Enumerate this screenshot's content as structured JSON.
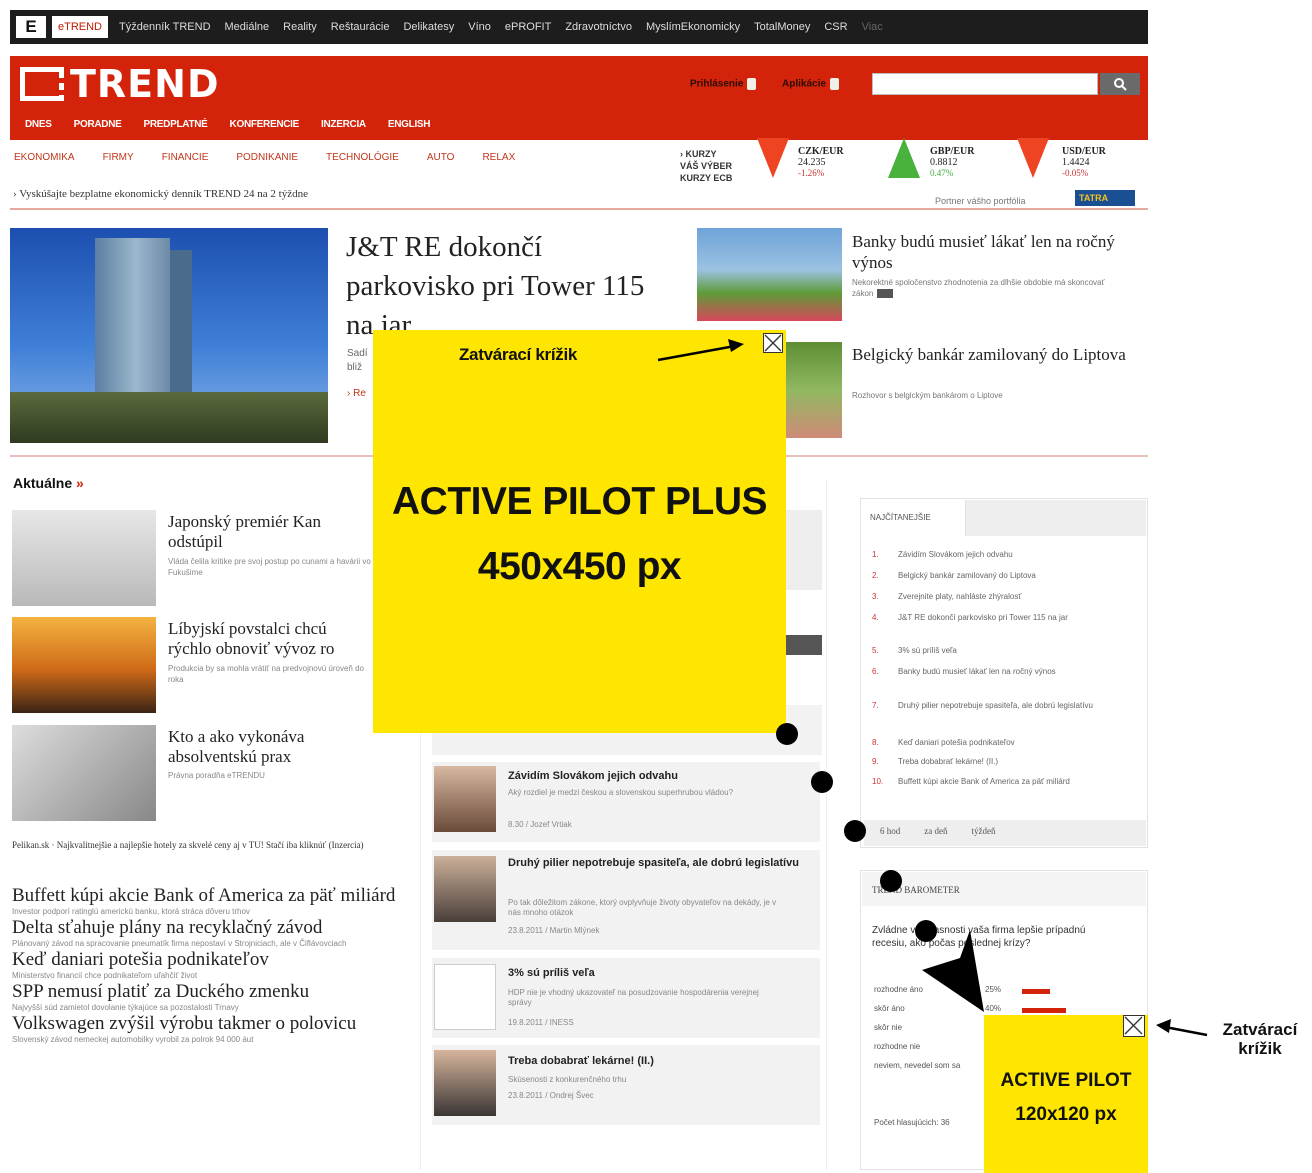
{
  "portal": {
    "logo": "E",
    "items": [
      {
        "label": "eTREND",
        "active": true
      },
      {
        "label": "Týždenník TREND"
      },
      {
        "label": "Mediálne"
      },
      {
        "label": "Reality"
      },
      {
        "label": "Reštaurácie"
      },
      {
        "label": "Delikatesy"
      },
      {
        "label": "Víno"
      },
      {
        "label": "ePROFIT"
      },
      {
        "label": "Zdravotníctvo"
      },
      {
        "label": "MyslímEkonomicky"
      },
      {
        "label": "TotalMoney"
      },
      {
        "label": "CSR"
      },
      {
        "label": "Viac",
        "faded": true
      }
    ]
  },
  "header": {
    "brand": "TREND",
    "login": "Prihlásenie",
    "register": "Aplikácie",
    "search_icon": "search-icon",
    "main_nav": [
      "DNES",
      "PORADNE",
      "PREDPLATNÉ",
      "KONFERENCIE",
      "INZERCIA",
      "ENGLISH"
    ],
    "sub_nav": [
      "EKONOMIKA",
      "FIRMY",
      "FINANCIE",
      "PODNIKANIE",
      "TECHNOLÓGIE",
      "AUTO",
      "RELAX"
    ],
    "promo": "› Vyskúšajte bezplatne ekonomický denník TREND 24 na 2 týždne"
  },
  "rates": {
    "labels": [
      "› KURZY",
      "VÁŠ VÝBER",
      "KURZY ECB"
    ],
    "items": [
      {
        "name": "CZK/EUR",
        "value": "24.235",
        "change": "-1.26%",
        "dir": "down"
      },
      {
        "name": "GBP/EUR",
        "value": "0.8812",
        "change": "0.47%",
        "dir": "up"
      },
      {
        "name": "USD/EUR",
        "value": "1.4424",
        "change": "-0.05%",
        "dir": "down"
      }
    ],
    "portfolio": "Portner vášho portfólia",
    "sponsor": "TATRA"
  },
  "hero": {
    "title": "J&T RE dokončí parkovisko pri Tower 115 na jar",
    "frag1": "Sadí",
    "frag2": "bliž",
    "frag3": "› Re"
  },
  "top_stories": [
    {
      "title": "Banky budú musieť lákať len na ročný výnos",
      "desc": "Nekorektné spoločenstvo zhodnotenia za dlhšie obdobie má skoncovať zákon"
    },
    {
      "title": "Belgický bankár zamilovaný do Liptova",
      "desc": "Rozhovor s belgickým bankárom o Liptove"
    }
  ],
  "aktualne": {
    "heading": "Aktuálne",
    "chevron": "»",
    "items": [
      {
        "title": "Japonský premiér Kan odstúpil",
        "desc": "Vláda čelila kritike pre svoj postup po cunami a havárii vo Fukušime"
      },
      {
        "title": "Líbyjskí povstalci chcú rýchlo obnoviť vývoz ro",
        "desc": "Produkcia by sa mohla vrátiť na predvojnovú úroveň do roka"
      },
      {
        "title": "Kto a ako vykonáva absolventskú prax",
        "desc": "Právna poradňa eTRENDU"
      }
    ],
    "pelikan": "Pelikan.sk · Najkvalitnejšie a najlepšie hotely za skvelé ceny aj v TU! Stačí iba kliknúť (Inzercia)",
    "list": [
      {
        "title": "Buffett kúpi akcie Bank of America za päť miliárd",
        "desc": "Investor podporí ratinglú americkú banku, ktorá stráca dôveru trhov"
      },
      {
        "title": "Delta sťahuje plány na recyklačný závod",
        "desc": "Plánovaný závod na spracovanie pneumatík firma nepostaví v Strojniciach, ale v Čiflávovciach"
      },
      {
        "title": "Keď daniari potešia podnikateľov",
        "desc": "Ministerstvo financií chce podnikateľom uľahčiť život"
      },
      {
        "title": "SPP nemusí platiť za Duckého zmenku",
        "desc": "Najvyšší súd zamietol dovolanie týkajúce sa pozostalosti Trnavy"
      },
      {
        "title": "Volkswagen zvýšil výrobu takmer o polovicu",
        "desc": "Slovenský závod nemeckej automobilky vyrobil za polrok 94 000 áut"
      }
    ]
  },
  "middle": {
    "items": [
      {
        "title": "Závidím Slovákom jejich odvahu",
        "desc": "Aký rozdiel je medzi českou a slovenskou superhrubou vládou?",
        "meta": "8.30 / Jozef Vrtiak"
      },
      {
        "title": "Druhý pilier nepotrebuje spasiteľa, ale dobrú legislatívu",
        "desc": "Po tak dôležitom zákone, ktorý ovplyvňuje životy obyvateľov na dekády, je v nás mnoho otázok",
        "meta": "23.8.2011 / Martin Mlýnek"
      },
      {
        "title": "3% sú príliš veľa",
        "desc": "HDP nie je vhodný ukazovateľ na posudzovanie hospodárenia verejnej správy",
        "meta": "19.8.2011 / INESS"
      },
      {
        "title": "Treba dobabrať lekárne! (II.)",
        "desc": "Skúsenosti z konkurenčného trhu",
        "meta": "23.8.2011 / Ondrej Švec"
      }
    ]
  },
  "najcitanejsie": {
    "tab": "NAJČÍTANEJŠIE",
    "items": [
      "Závidím Slovákom jejich odvahu",
      "Belgický bankár zamilovaný do Liptova",
      "Zverejnite platy, nahláste zhýralosť",
      "J&T RE dokončí parkovisko pri Tower 115 na jar",
      "3% sú príliš veľa",
      "Banky budú musieť lákať len na ročný výnos",
      "Druhý pilier nepotrebuje spasiteľa, ale dobrú legislatívu",
      "Keď daniari potešia podnikateľov",
      "Treba dobabrať lekárne! (II.)",
      "Buffett kúpi akcie Bank of America za päť miliárd"
    ],
    "periods": [
      "6 hod",
      "za deň",
      "týždeň"
    ]
  },
  "barometer": {
    "title": "TREND BAROMETER",
    "question": "Zvládne v súčasnosti vaša firma lepšie prípadnú recesiu, ako počas poslednej krízy?",
    "rows": [
      {
        "label": "rozhodne áno",
        "pct": "25%",
        "frac": 0.25
      },
      {
        "label": "skôr áno",
        "pct": "40%",
        "frac": 0.4
      },
      {
        "label": "skôr nie",
        "pct": "",
        "frac": 0
      },
      {
        "label": "rozhodne nie",
        "pct": "",
        "frac": 0
      },
      {
        "label": "neviem, nevedel som sa",
        "pct": "",
        "frac": 0
      }
    ],
    "count": "Počet hlasujúcich: 36"
  },
  "overlay": {
    "big_ad": {
      "line1": "ACTIVE PILOT PLUS",
      "line2": "450x450 px"
    },
    "small_ad": {
      "line1": "ACTIVE PILOT",
      "line2": "120x120 px"
    },
    "close_label_left": "Zatvárací krížik",
    "close_label_right": "Zatvárací krížik",
    "colors": {
      "ad": "#ffe600",
      "brand": "#d4230b"
    }
  }
}
